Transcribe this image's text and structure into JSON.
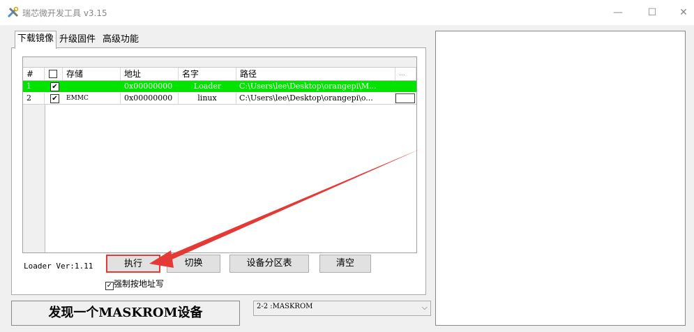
{
  "window": {
    "title": "瑞芯微开发工具 v3.15",
    "controls": {
      "minimize": "—",
      "maximize": "☐",
      "close": "✕"
    }
  },
  "tabs": [
    {
      "label": "下载镜像",
      "active": true
    },
    {
      "label": "升级固件",
      "active": false
    },
    {
      "label": "高级功能",
      "active": false
    }
  ],
  "table": {
    "columns": [
      "#",
      "",
      "存储",
      "地址",
      "名字",
      "路径",
      "..."
    ],
    "rows": [
      {
        "num": "1",
        "checked": true,
        "storage": "",
        "address": "0x00000000",
        "name": "Loader",
        "path": "C:\\Users\\lee\\Desktop\\orangepi\\M...",
        "highlight": true
      },
      {
        "num": "2",
        "checked": true,
        "storage": "EMMC",
        "address": "0x00000000",
        "name": "linux",
        "path": "C:\\Users\\lee\\Desktop\\orangepi\\o...",
        "highlight": false
      }
    ],
    "highlight_color": "#00e400"
  },
  "loader_version": "Loader Ver:1.11",
  "buttons": {
    "execute": "执行",
    "switch": "切换",
    "partition_table": "设备分区表",
    "clear": "清空"
  },
  "force_write": {
    "label": "强制按地址写",
    "checked": true
  },
  "status_text": "发现一个MASKROM设备",
  "device_select": {
    "value": "2-2 :MASKROM"
  },
  "annotation_color": "#e53935"
}
